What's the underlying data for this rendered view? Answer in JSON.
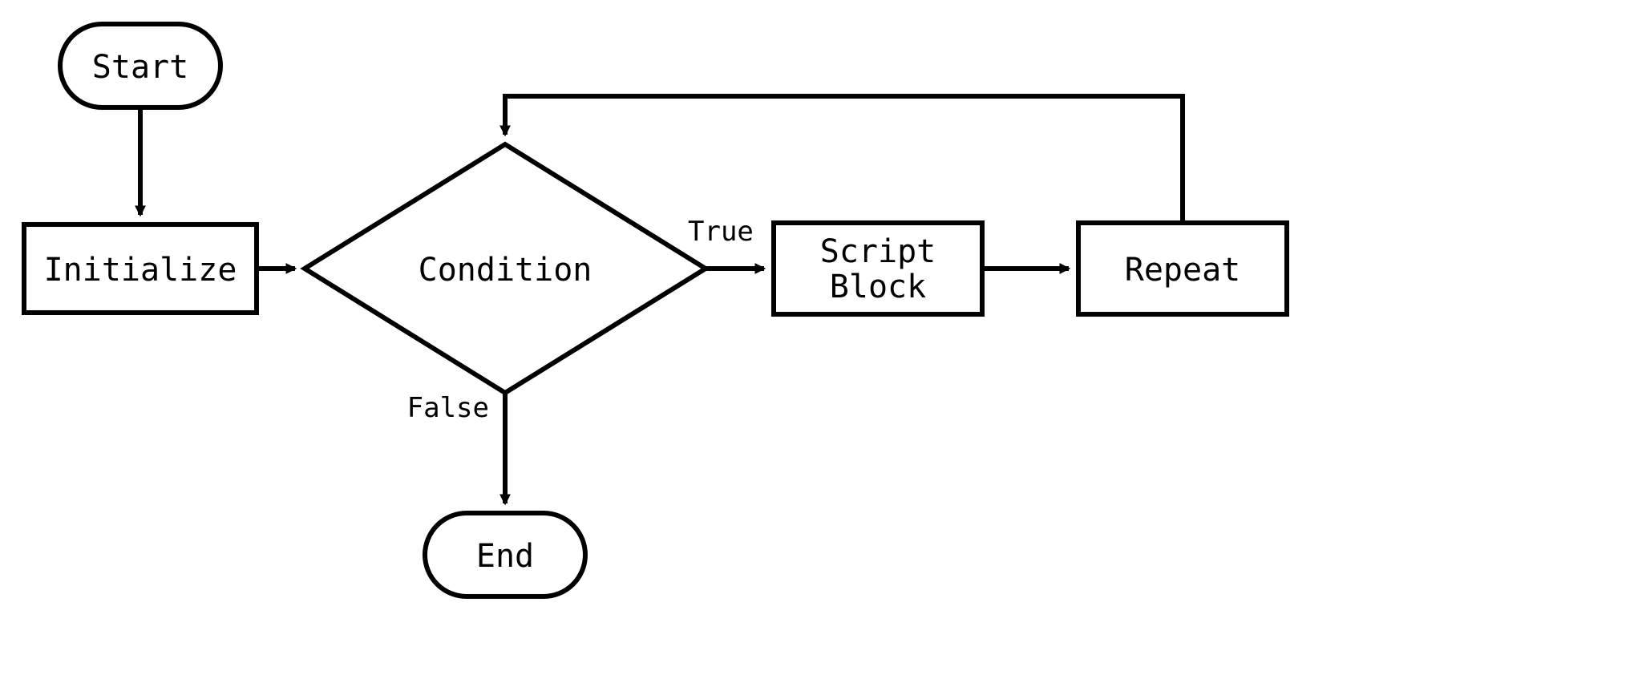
{
  "nodes": {
    "start": {
      "label": "Start"
    },
    "initialize": {
      "label": "Initialize"
    },
    "condition": {
      "label": "Condition"
    },
    "scriptblock": {
      "line1": "Script",
      "line2": "Block"
    },
    "repeat": {
      "label": "Repeat"
    },
    "end": {
      "label": "End"
    }
  },
  "edges": {
    "true": {
      "label": "True"
    },
    "false": {
      "label": "False"
    }
  }
}
